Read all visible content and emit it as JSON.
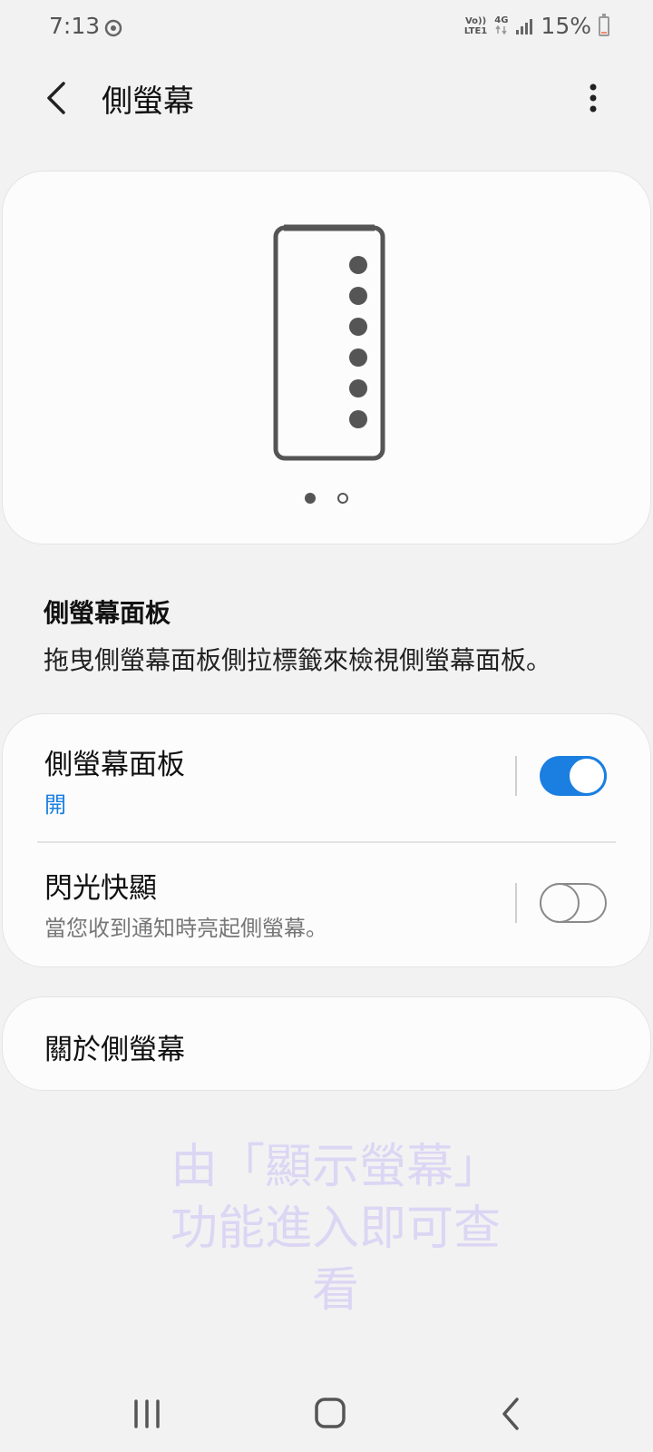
{
  "status_bar": {
    "time": "7:13",
    "volte_top": "Vo))",
    "volte_bottom": "LTE1",
    "network_type": "4G",
    "battery_text": "15%",
    "battery_level": 0.15
  },
  "app_bar": {
    "title": "側螢幕"
  },
  "preview": {
    "page_count": 2,
    "current_page": 1
  },
  "section": {
    "heading": "側螢幕面板",
    "description": "拖曳側螢幕面板側拉標籤來檢視側螢幕面板。"
  },
  "settings": {
    "edge_panels": {
      "title": "側螢幕面板",
      "status": "開",
      "enabled": true
    },
    "edge_lighting": {
      "title": "閃光快顯",
      "description": "當您收到通知時亮起側螢幕。",
      "enabled": false
    }
  },
  "about": {
    "label": "關於側螢幕"
  },
  "watermark": {
    "line1": "由「顯示螢幕」",
    "line2": "功能進入即可查",
    "line3": "看"
  },
  "colors": {
    "accent": "#1a7fe0",
    "background": "#f2f2f2",
    "card": "#fcfcfc"
  }
}
